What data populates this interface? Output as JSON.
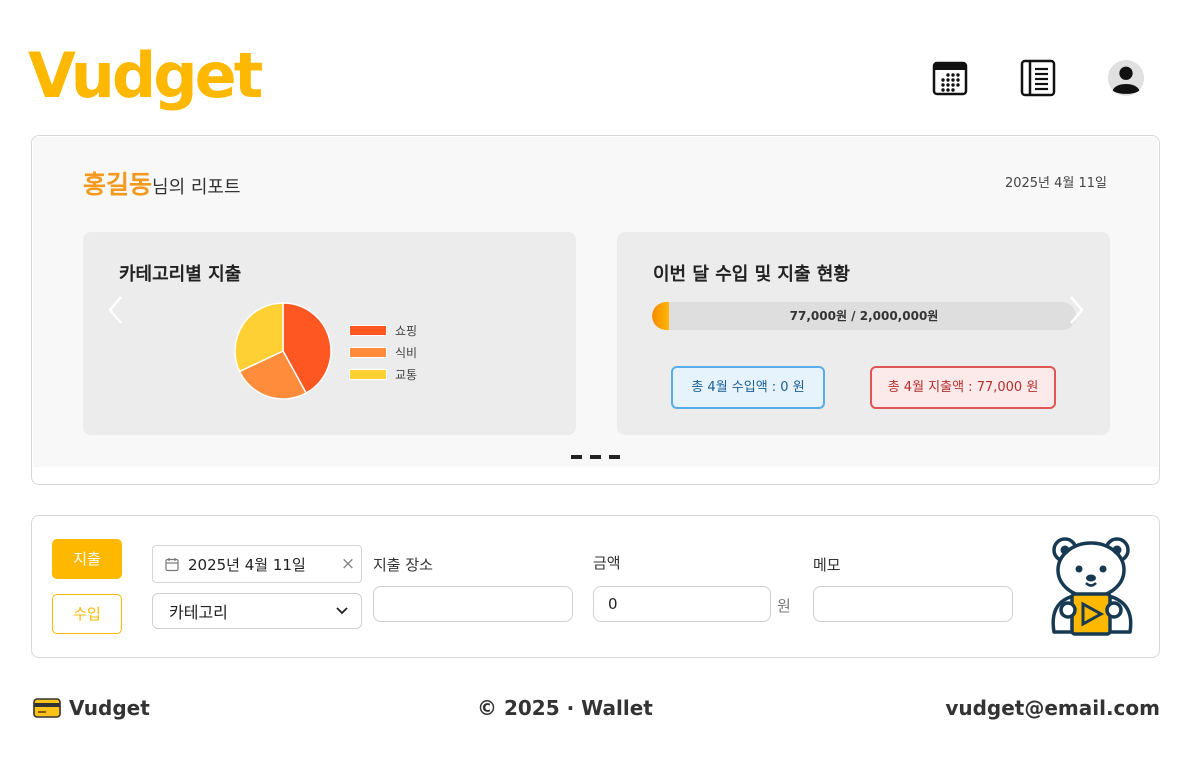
{
  "header": {
    "logo": "Vudget",
    "icons": [
      "calendar-icon",
      "ledger-icon",
      "user-avatar-icon"
    ]
  },
  "report": {
    "user_name": "홍길동",
    "title_suffix": "님의 리포트",
    "date": "2025년 4월 11일",
    "category_panel": {
      "title": "카테고리별 지출"
    },
    "summary_panel": {
      "title": "이번 달 수입 및 지출 현황",
      "progress_text": "77,000원 / 2,000,000원",
      "progress_fraction": 0.0385,
      "income_badge": "총 4월 수입액 : 0 원",
      "expense_badge": "총 4월 지출액 : 77,000 원"
    },
    "carousel_dots": 3
  },
  "chart_data": {
    "type": "pie",
    "title": "카테고리별 지출",
    "labels": [
      "쇼핑",
      "식비",
      "교통"
    ],
    "values": [
      42,
      26,
      32
    ],
    "colors": [
      "#FF5722",
      "#FF8C3A",
      "#FFD033"
    ]
  },
  "form": {
    "expense_button": "지출",
    "income_button": "수입",
    "date_value": "2025년 4월 11일",
    "category_placeholder": "카테고리",
    "place_label": "지출 장소",
    "place_value": "",
    "amount_label": "금액",
    "amount_value": "0",
    "amount_unit": "원",
    "memo_label": "메모",
    "memo_value": ""
  },
  "footer": {
    "brand": "Vudget",
    "copyright": "© 2025 · Wallet",
    "email": "vudget@email.com"
  },
  "colors": {
    "accent": "#FFB800",
    "username": "#F39A1E",
    "income": "#58AEEA",
    "expense": "#E25555"
  }
}
